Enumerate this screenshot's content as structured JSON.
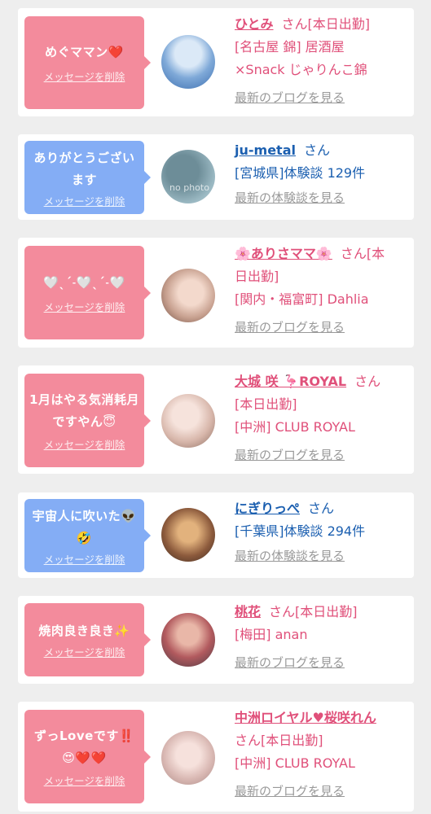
{
  "cards": [
    {
      "message": "めぐママン❤️",
      "delete_label": "メッセージを削除",
      "name": "ひとみ",
      "suffix": "さん[本日出勤]",
      "line2": "[名古屋 錦] 居酒屋",
      "line3": "×Snack じゃりんこ錦",
      "link": "最新のブログを見る"
    },
    {
      "message": "ありがとうございます",
      "delete_label": "メッセージを削除",
      "name": "ju-metal",
      "suffix": "さん",
      "line2": "[宮城県]体験談 129件",
      "link": "最新の体験談を見る",
      "avatar_text": "no photo"
    },
    {
      "message": "🤍ˎˊ˗🤍ˎˊ˗🤍",
      "delete_label": "メッセージを削除",
      "name": "🌸ありさママ🌸",
      "suffix": "さん[本",
      "line2": "日出勤]",
      "line3": "[関内・福富町] Dahlia",
      "link": "最新のブログを見る"
    },
    {
      "message": "1月はやる気消耗月ですやん😇",
      "delete_label": "メッセージを削除",
      "name": "大城 咲 🦩ROYAL",
      "suffix": "さん",
      "line2": "[本日出勤]",
      "line3": "[中洲] CLUB ROYAL",
      "link": "最新のブログを見る"
    },
    {
      "message": "宇宙人に吹いた👽🤣",
      "delete_label": "メッセージを削除",
      "name": "にぎりっぺ",
      "suffix": "さん",
      "line2": "[千葉県]体験談 294件",
      "link": "最新の体験談を見る"
    },
    {
      "message": "焼肉良き良き✨",
      "delete_label": "メッセージを削除",
      "name": "桃花",
      "suffix": "さん[本日出勤]",
      "line2": "[梅田] anan",
      "link": "最新のブログを見る"
    },
    {
      "message": "ずっLoveです‼️😍❤️❤️",
      "delete_label": "メッセージを削除",
      "name": "中洲ロイヤル♥桜咲れん",
      "line2": "さん[本日出勤]",
      "line3": "[中洲] CLUB ROYAL",
      "link": "最新のブログを見る"
    }
  ],
  "colors": {
    "pink_bubble": "#f38b9c",
    "blue_bubble": "#84adf5",
    "pink_text": "#e0507a",
    "blue_text": "#1b5fb0",
    "link_gray": "#999999",
    "background": "#eeeeee"
  }
}
